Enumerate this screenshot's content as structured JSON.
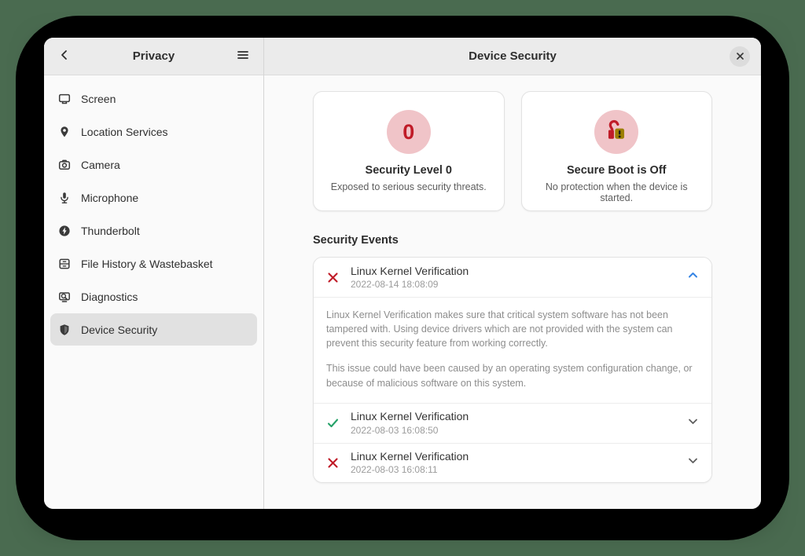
{
  "colors": {
    "outer_background": "#4a6b50",
    "screen_background": "#000000",
    "accent_blue": "#3584e4",
    "danger_red": "#c01c28",
    "success_green": "#26a269",
    "warning_yellow": "#9c7e00",
    "badge_pink": "#f0c4c8"
  },
  "sidebar": {
    "title": "Privacy",
    "items": [
      {
        "label": "Screen",
        "icon": "display-icon",
        "selected": false
      },
      {
        "label": "Location Services",
        "icon": "location-icon",
        "selected": false
      },
      {
        "label": "Camera",
        "icon": "camera-icon",
        "selected": false
      },
      {
        "label": "Microphone",
        "icon": "microphone-icon",
        "selected": false
      },
      {
        "label": "Thunderbolt",
        "icon": "thunderbolt-icon",
        "selected": false
      },
      {
        "label": "File History & Wastebasket",
        "icon": "drawer-icon",
        "selected": false
      },
      {
        "label": "Diagnostics",
        "icon": "diagnostics-icon",
        "selected": false
      },
      {
        "label": "Device Security",
        "icon": "shield-icon",
        "selected": true
      }
    ]
  },
  "main": {
    "title": "Device Security",
    "cards": [
      {
        "badge_value": "0",
        "icon": "security-level-badge",
        "title": "Security Level 0",
        "subtitle": "Exposed to serious security threats."
      },
      {
        "icon": "unlocked-warning-icon",
        "title": "Secure Boot is Off",
        "subtitle": "No protection when the device is started."
      }
    ],
    "events_heading": "Security Events",
    "events": [
      {
        "status": "fail",
        "title": "Linux Kernel Verification",
        "timestamp": "2022-08-14 18:08:09",
        "expanded": true,
        "description": [
          "Linux Kernel Verification makes sure that critical system software has not been tampered with. Using device drivers which are not provided with the system can prevent this security feature from working correctly.",
          "This issue could have been caused by an operating system configuration change, or because of malicious software on this system."
        ]
      },
      {
        "status": "pass",
        "title": "Linux Kernel Verification",
        "timestamp": "2022-08-03 16:08:50",
        "expanded": false
      },
      {
        "status": "fail",
        "title": "Linux Kernel Verification",
        "timestamp": "2022-08-03 16:08:11",
        "expanded": false
      }
    ]
  }
}
